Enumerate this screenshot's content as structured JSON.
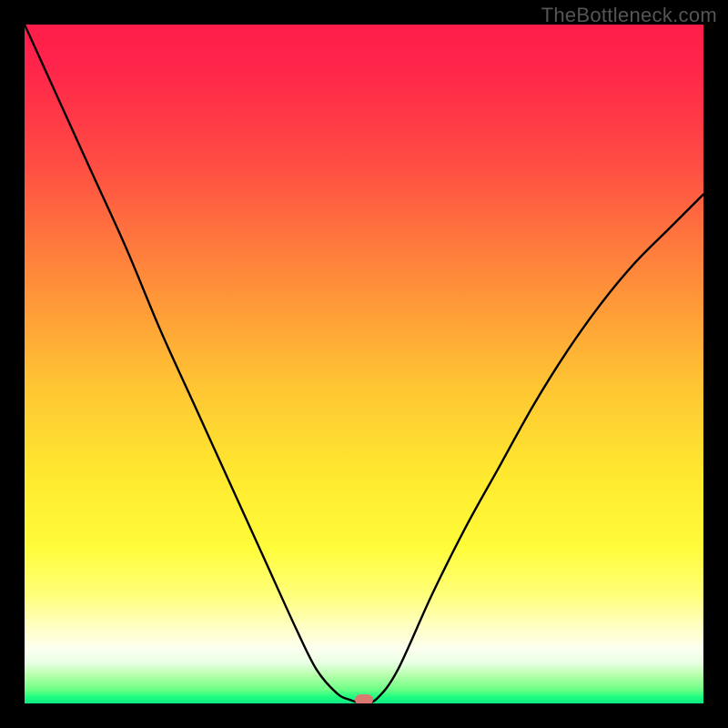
{
  "watermark": "TheBottleneck.com",
  "chart_data": {
    "type": "line",
    "title": "",
    "xlabel": "",
    "ylabel": "",
    "xlim": [
      0,
      1
    ],
    "ylim": [
      0,
      1
    ],
    "x": [
      0.0,
      0.05,
      0.1,
      0.15,
      0.2,
      0.25,
      0.3,
      0.35,
      0.4,
      0.43,
      0.46,
      0.48,
      0.5,
      0.52,
      0.55,
      0.6,
      0.65,
      0.7,
      0.75,
      0.8,
      0.85,
      0.9,
      0.95,
      1.0
    ],
    "values": [
      1.0,
      0.89,
      0.78,
      0.67,
      0.55,
      0.44,
      0.33,
      0.22,
      0.11,
      0.05,
      0.015,
      0.005,
      0.0,
      0.008,
      0.05,
      0.16,
      0.26,
      0.35,
      0.44,
      0.52,
      0.59,
      0.65,
      0.7,
      0.75
    ],
    "marker": {
      "x": 0.5,
      "y": 0.0
    },
    "background_gradient": {
      "stops": [
        {
          "pos": 0.0,
          "color": "#ff1e4a"
        },
        {
          "pos": 0.38,
          "color": "#ff8e3a"
        },
        {
          "pos": 0.77,
          "color": "#fffc39"
        },
        {
          "pos": 1.0,
          "color": "#0de885"
        }
      ]
    },
    "border_color": "#000000"
  }
}
